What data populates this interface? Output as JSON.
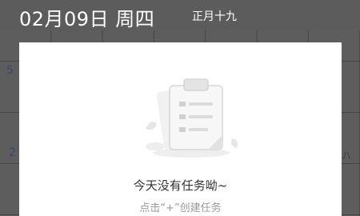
{
  "header": {
    "date_title": "02月09日 周四",
    "lunar_date": "正月十九"
  },
  "calendar_background": {
    "visible_numbers": [
      "5",
      "2",
      "八"
    ]
  },
  "empty_state": {
    "title": "今天没有任务呦~",
    "hint": "点击“+”创建任务",
    "icon": "clipboard-icon"
  },
  "colors": {
    "header_bg": "#5c5c5c",
    "card_bg": "#ffffff",
    "title_text": "#333333",
    "hint_text": "#9a9a9a",
    "calendar_number": "#4a6fa5"
  }
}
